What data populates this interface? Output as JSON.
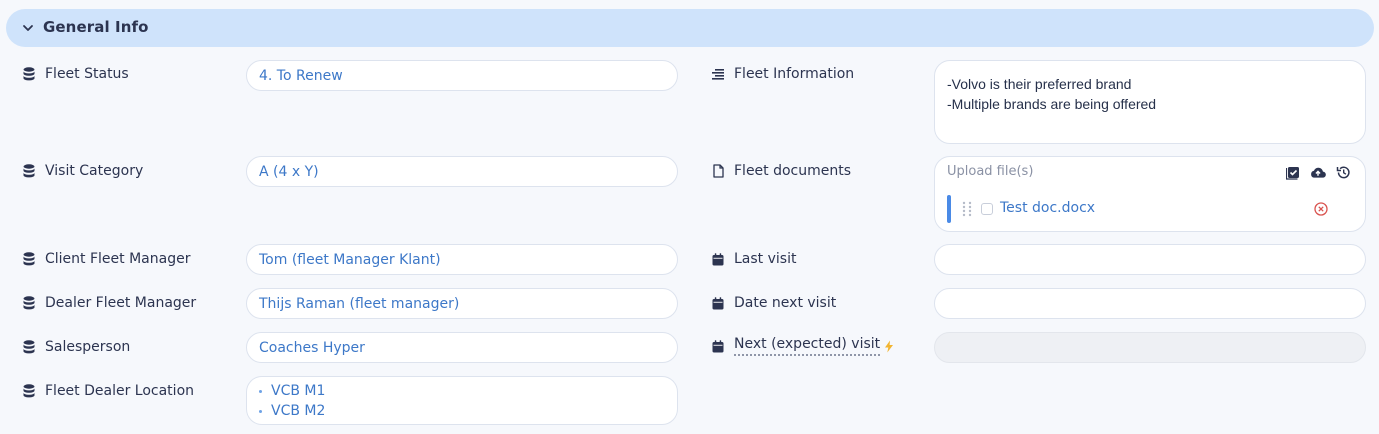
{
  "section": {
    "title": "General Info",
    "icon": "chevron-down-icon"
  },
  "left": {
    "fleet_status": {
      "label": "Fleet Status",
      "value": "4. To Renew",
      "icon": "database-icon"
    },
    "visit_category": {
      "label": "Visit Category",
      "value": "A (4 x Y)",
      "icon": "database-icon"
    },
    "client_fleet_manager": {
      "label": "Client Fleet Manager",
      "value": "Tom (fleet Manager Klant)",
      "icon": "database-icon"
    },
    "dealer_fleet_manager": {
      "label": "Dealer Fleet Manager",
      "value": "Thijs Raman (fleet manager)",
      "icon": "database-icon"
    },
    "salesperson": {
      "label": "Salesperson",
      "value": "Coaches Hyper",
      "icon": "database-icon"
    },
    "fleet_dealer_location": {
      "label": "Fleet Dealer Location",
      "values": [
        "VCB M1",
        "VCB M2"
      ],
      "icon": "database-icon"
    }
  },
  "right": {
    "fleet_information": {
      "label": "Fleet Information",
      "lines": [
        "-Volvo is their preferred brand",
        "-Multiple brands are being offered"
      ],
      "icon": "text-lines-icon"
    },
    "fleet_documents": {
      "label": "Fleet documents",
      "placeholder": "Upload file(s)",
      "file": "Test doc.docx",
      "icon": "document-icon",
      "tools": [
        "checklist-icon",
        "cloud-upload-icon",
        "history-icon"
      ]
    },
    "last_visit": {
      "label": "Last visit",
      "value": "",
      "icon": "calendar-icon"
    },
    "date_next_visit": {
      "label": "Date next visit",
      "value": "",
      "icon": "calendar-icon"
    },
    "next_expected_visit": {
      "label": "Next (expected) visit",
      "value": "",
      "icon": "calendar-icon",
      "badge": "lightning-icon"
    }
  },
  "colors": {
    "header_bg": "#cfe3fb",
    "value_text": "#3d78c8",
    "label_text": "#2c3450",
    "accent_bar": "#4a8ae6",
    "remove": "#d9534f",
    "lightning": "#f2b531"
  }
}
